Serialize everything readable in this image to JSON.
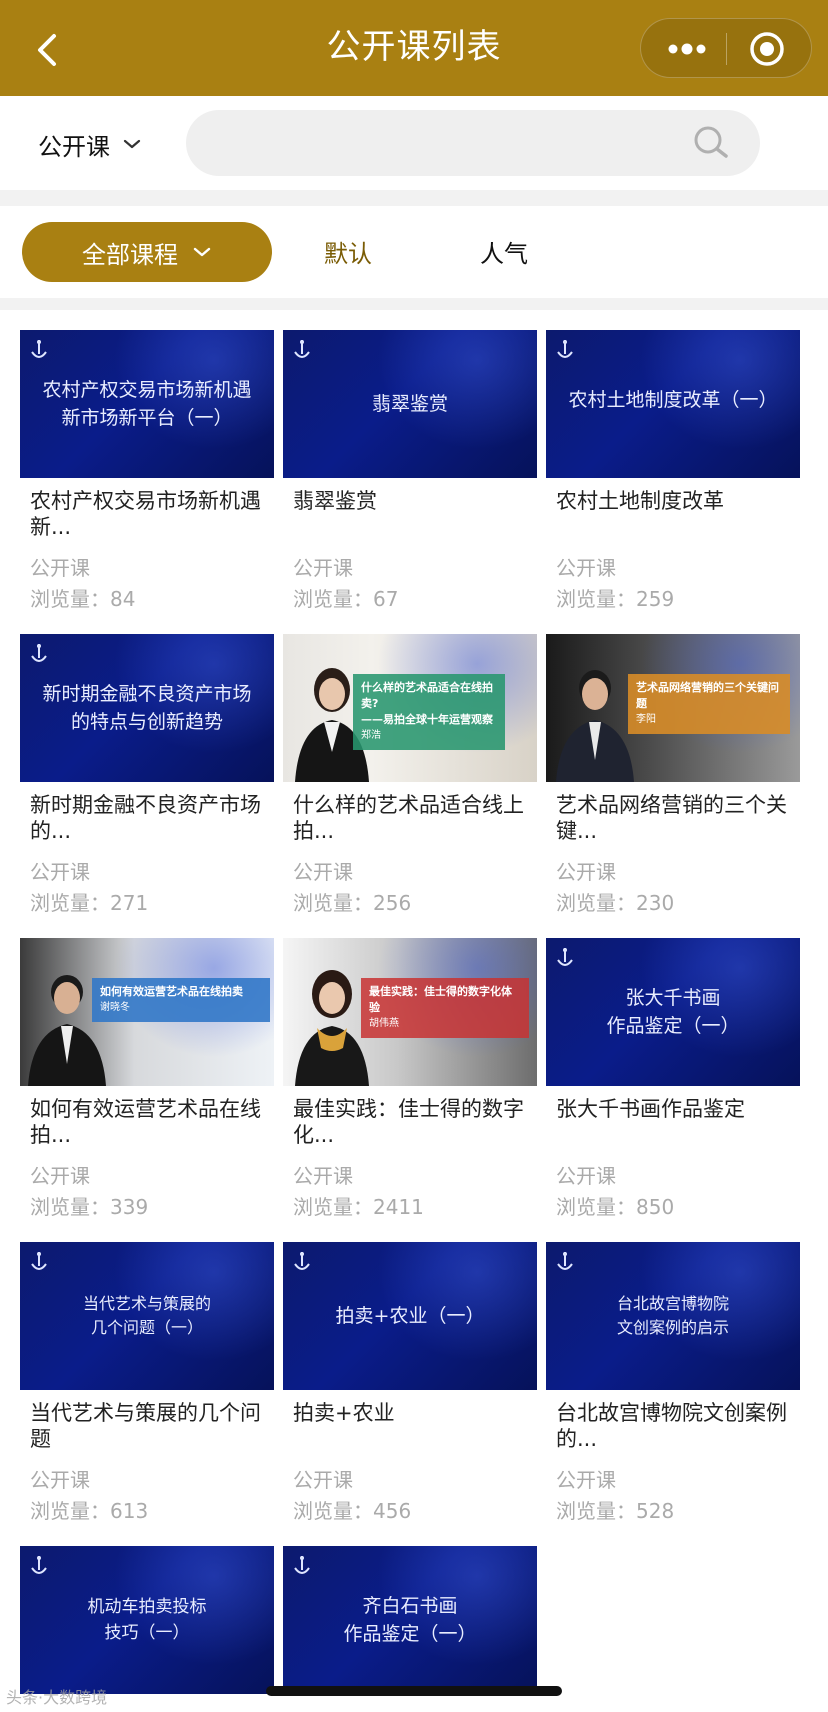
{
  "header": {
    "title": "公开课列表",
    "back_icon": "chevron-left-icon",
    "more_icon": "more-dots-icon",
    "close_icon": "target-circle-icon"
  },
  "search": {
    "category_label": "公开课",
    "category_icon": "chevron-down-icon",
    "placeholder": "",
    "icon": "search-icon"
  },
  "filters": {
    "all_label": "全部课程",
    "default_label": "默认",
    "popular_label": "人气"
  },
  "colors": {
    "brand": "#a98012",
    "muted_text": "#aaaaaa",
    "thumb_blue": "#0a1c8a"
  },
  "courses": [
    {
      "thumb_text": "农村产权交易市场新机遇\n新市场新平台（一）",
      "title": "农村产权交易市场新机遇新...",
      "type": "公开课",
      "views": "浏览量：84"
    },
    {
      "thumb_text": "翡翠鉴赏",
      "title": "翡翠鉴赏",
      "type": "公开课",
      "views": "浏览量：67"
    },
    {
      "thumb_text": "农村土地制度改革（一）",
      "title": "农村土地制度改革",
      "type": "公开课",
      "views": "浏览量：259"
    },
    {
      "thumb_text": "新时期金融不良资产市场\n的特点与创新趋势",
      "title": "新时期金融不良资产市场的...",
      "type": "公开课",
      "views": "浏览量：271"
    },
    {
      "banner_title": "什么样的艺术品适合在线拍卖?\n——易拍全球十年运营观察",
      "banner_name": "郑浩",
      "title": "什么样的艺术品适合线上拍...",
      "type": "公开课",
      "views": "浏览量：256"
    },
    {
      "banner_title": "艺术品网络营销的三个关键问题",
      "banner_name": "李阳",
      "title": "艺术品网络营销的三个关键...",
      "type": "公开课",
      "views": "浏览量：230"
    },
    {
      "banner_title": "如何有效运营艺术品在线拍卖",
      "banner_name": "谢晓冬",
      "title": "如何有效运营艺术品在线拍...",
      "type": "公开课",
      "views": "浏览量：339"
    },
    {
      "banner_title": "最佳实践：佳士得的数字化体验",
      "banner_name": "胡伟燕",
      "title": "最佳实践：佳士得的数字化...",
      "type": "公开课",
      "views": "浏览量：2411"
    },
    {
      "thumb_text": "张大千书画\n作品鉴定（一）",
      "title": "张大千书画作品鉴定",
      "type": "公开课",
      "views": "浏览量：850"
    },
    {
      "thumb_text": "当代艺术与策展的\n几个问题（一）",
      "title": "当代艺术与策展的几个问题",
      "type": "公开课",
      "views": "浏览量：613"
    },
    {
      "thumb_text": "拍卖+农业（一）",
      "title": "拍卖+农业",
      "type": "公开课",
      "views": "浏览量：456"
    },
    {
      "thumb_text": "台北故宫博物院\n文创案例的启示",
      "title": "台北故宫博物院文创案例的...",
      "type": "公开课",
      "views": "浏览量：528"
    },
    {
      "thumb_text": "机动车拍卖投标\n技巧（一）",
      "title": "",
      "type": "",
      "views": ""
    },
    {
      "thumb_text": "齐白石书画\n作品鉴定（一）",
      "title": "",
      "type": "",
      "views": ""
    }
  ],
  "watermark": "头条·大数跨境"
}
